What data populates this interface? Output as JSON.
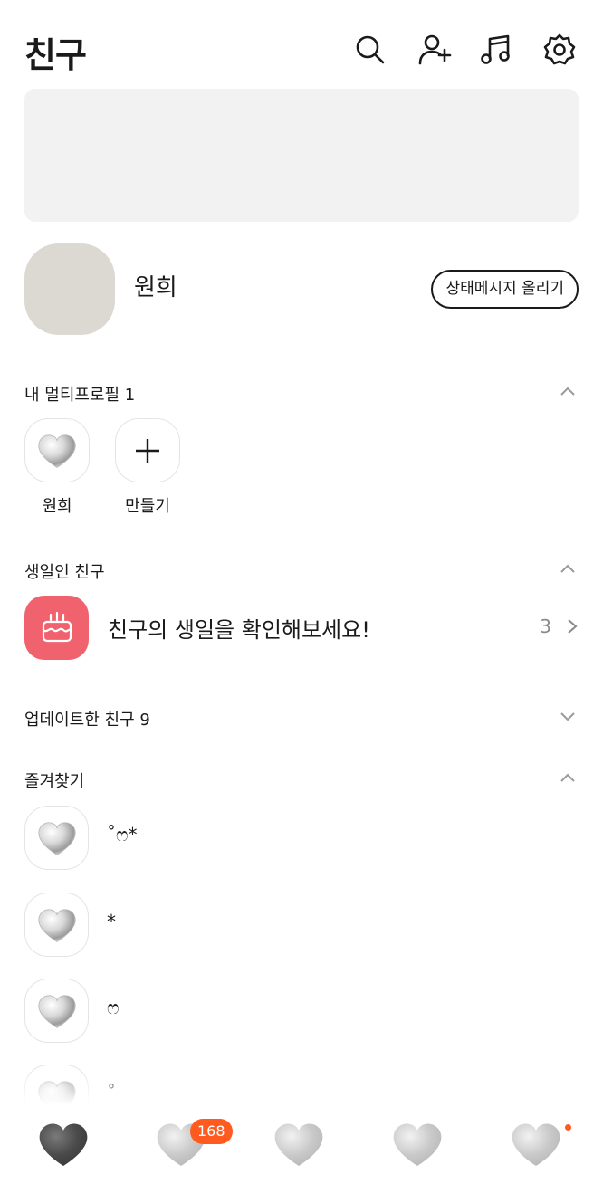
{
  "header": {
    "title": "친구",
    "icons": [
      "search-icon",
      "add-friend-icon",
      "music-icon",
      "settings-icon"
    ]
  },
  "profile": {
    "name": "원희",
    "status_button": "상태메시지 올리기"
  },
  "multi_profile": {
    "title": "내 멀티프로필 1",
    "items": [
      {
        "label": "원희",
        "icon": "heart-image"
      },
      {
        "label": "만들기",
        "icon": "plus-icon"
      }
    ]
  },
  "birthday": {
    "title": "생일인 친구",
    "message": "친구의 생일을 확인해보세요!",
    "count": "3",
    "accent": "#f0626e"
  },
  "updated": {
    "title": "업데이트한 친구 9"
  },
  "favorites": {
    "title": "즐겨찾기",
    "items": [
      {
        "name": "˚ෆ*"
      },
      {
        "name": "*"
      },
      {
        "name": "ෆ"
      },
      {
        "name": "˚"
      }
    ]
  },
  "tabbar": {
    "badge": "168",
    "badge_color": "#ff5a1f",
    "tabs": [
      "friends-tab",
      "chats-tab",
      "openchat-tab",
      "shopping-tab",
      "more-tab"
    ]
  }
}
